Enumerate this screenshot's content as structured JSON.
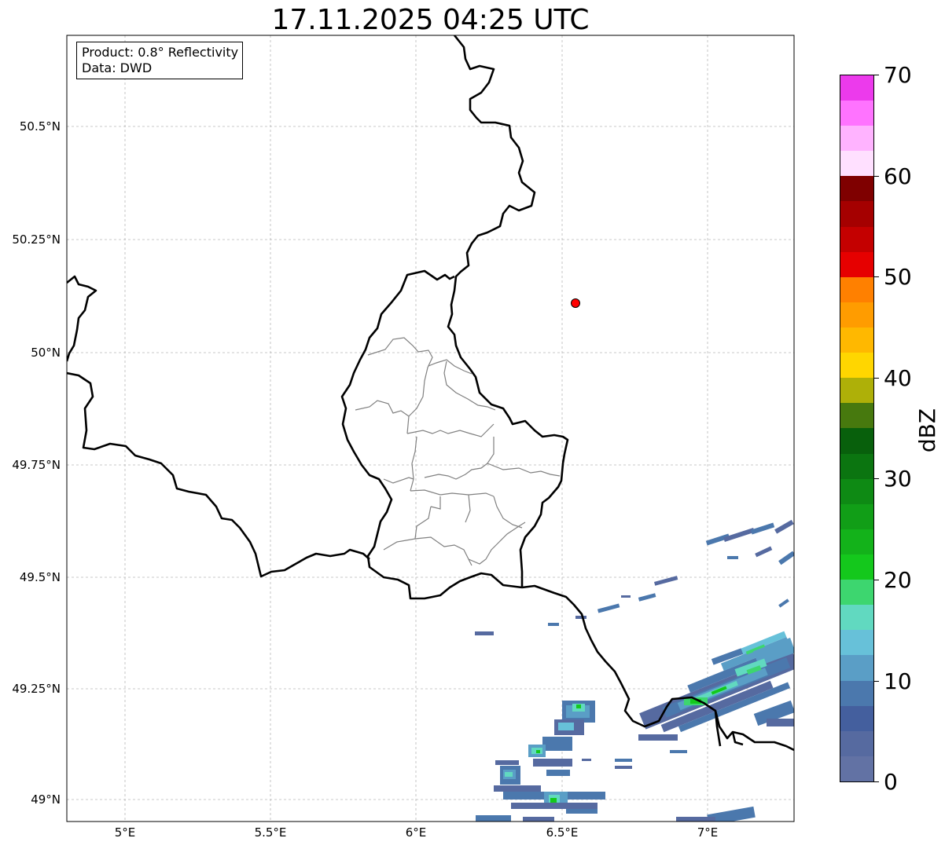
{
  "title": "17.11.2025 04:25 UTC",
  "info": {
    "product": "Product: 0.8° Reflectivity",
    "source": "Data: DWD"
  },
  "axes": {
    "lat_ticks": [
      "50.5°N",
      "50.25°N",
      "50°N",
      "49.75°N",
      "49.5°N",
      "49.25°N",
      "49°N"
    ],
    "lon_ticks": [
      "5°E",
      "5.5°E",
      "6°E",
      "6.5°E",
      "7°E"
    ],
    "lon_range": [
      4.8,
      7.3
    ],
    "lat_range": [
      48.95,
      50.7
    ],
    "grid": true
  },
  "colorbar": {
    "unit": "dBZ",
    "range": [
      0,
      70
    ],
    "tick_labels": [
      "0",
      "10",
      "20",
      "30",
      "40",
      "50",
      "60",
      "70"
    ],
    "colors": [
      "#6272a4",
      "#566aa0",
      "#445f9e",
      "#4b78ad",
      "#5a9ec6",
      "#67c1d9",
      "#61d9c0",
      "#3dd66f",
      "#14c81c",
      "#13b21a",
      "#119e17",
      "#0e8a14",
      "#0b7510",
      "#08600c",
      "#47790e",
      "#aeb008",
      "#ffd600",
      "#ffb800",
      "#ff9c00",
      "#ff8000",
      "#e60000",
      "#c40000",
      "#a50000",
      "#7f0000",
      "#ffe0ff",
      "#ffb3ff",
      "#ff73ff",
      "#ec3aec"
    ]
  },
  "markers": [
    {
      "name": "site-marker",
      "lon": 6.55,
      "lat": 50.11,
      "color": "#ff0000"
    }
  ],
  "palette": {
    "border": "#000000",
    "admin": "#808080",
    "grid": "#b0b0b0"
  }
}
